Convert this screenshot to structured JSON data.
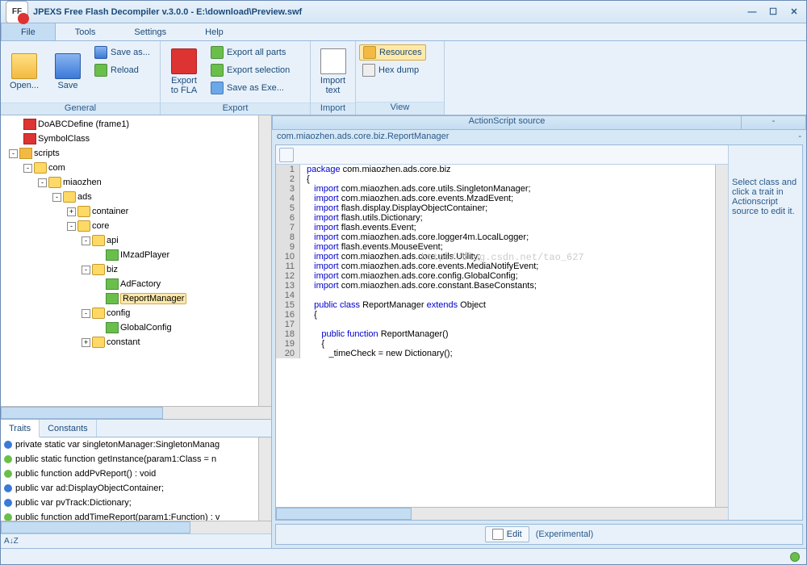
{
  "app": {
    "logo": "FF",
    "title": "JPEXS Free Flash Decompiler v.3.0.0 - E:\\download\\Preview.swf"
  },
  "menu": {
    "file": "File",
    "tools": "Tools",
    "settings": "Settings",
    "help": "Help"
  },
  "ribbon": {
    "general": {
      "label": "General",
      "open": "Open...",
      "save": "Save",
      "saveas": "Save as...",
      "reload": "Reload"
    },
    "export": {
      "label": "Export",
      "tofla": "Export\nto FLA",
      "allparts": "Export all parts",
      "selection": "Export selection",
      "saveasexe": "Save as Exe..."
    },
    "import": {
      "label": "Import",
      "importtext": "Import\ntext"
    },
    "view": {
      "label": "View",
      "resources": "Resources",
      "hexdump": "Hex dump"
    }
  },
  "tree": {
    "n0": "DoABCDefine (frame1)",
    "n1": "SymbolClass",
    "n2": "scripts",
    "n3": "com",
    "n4": "miaozhen",
    "n5": "ads",
    "n6": "container",
    "n7": "core",
    "n8": "api",
    "n9": "IMzadPlayer",
    "n10": "biz",
    "n11": "AdFactory",
    "n12": "ReportManager",
    "n13": "config",
    "n14": "GlobalConfig",
    "n15": "constant"
  },
  "traits": {
    "tab1": "Traits",
    "tab2": "Constants",
    "t0": "private static var singletonManager:SingletonManag",
    "t1": "public static function getInstance(param1:Class = n",
    "t2": "public function addPvReport() : void",
    "t3": "public var ad:DisplayObjectContainer;",
    "t4": "public var pvTrack:Dictionary;",
    "t5": "public function addTimeReport(param1:Function) : v",
    "sort": "A↓Z"
  },
  "source": {
    "title": "ActionScript source",
    "mini": "-",
    "path": "com.miaozhen.ads.core.biz.ReportManager",
    "pathm": "-",
    "info": "Select class and click a trait in Actionscript source to edit it.",
    "edit": "Edit",
    "exp": "(Experimental)",
    "lines": [
      {
        "n": "1",
        "pre": "",
        "kw": "package",
        "post": " com.miaozhen.ads.core.biz"
      },
      {
        "n": "2",
        "pre": "",
        "kw": "",
        "post": "{"
      },
      {
        "n": "3",
        "pre": "   ",
        "kw": "import",
        "post": " com.miaozhen.ads.core.utils.SingletonManager;"
      },
      {
        "n": "4",
        "pre": "   ",
        "kw": "import",
        "post": " com.miaozhen.ads.core.events.MzadEvent;"
      },
      {
        "n": "5",
        "pre": "   ",
        "kw": "import",
        "post": " flash.display.DisplayObjectContainer;"
      },
      {
        "n": "6",
        "pre": "   ",
        "kw": "import",
        "post": " flash.utils.Dictionary;"
      },
      {
        "n": "7",
        "pre": "   ",
        "kw": "import",
        "post": " flash.events.Event;"
      },
      {
        "n": "8",
        "pre": "   ",
        "kw": "import",
        "post": " com.miaozhen.ads.core.logger4m.LocalLogger;"
      },
      {
        "n": "9",
        "pre": "   ",
        "kw": "import",
        "post": " flash.events.MouseEvent;"
      },
      {
        "n": "10",
        "pre": "   ",
        "kw": "import",
        "post": " com.miaozhen.ads.core.utils.Utility;"
      },
      {
        "n": "11",
        "pre": "   ",
        "kw": "import",
        "post": " com.miaozhen.ads.core.events.MediaNotifyEvent;"
      },
      {
        "n": "12",
        "pre": "   ",
        "kw": "import",
        "post": " com.miaozhen.ads.core.config.GlobalConfig;"
      },
      {
        "n": "13",
        "pre": "   ",
        "kw": "import",
        "post": " com.miaozhen.ads.core.constant.BaseConstants;"
      },
      {
        "n": "14",
        "pre": "",
        "kw": "",
        "post": ""
      },
      {
        "n": "15",
        "pre": "   ",
        "kw": "public class",
        "post": " ReportManager ",
        "kw2": "extends",
        "post2": " Object"
      },
      {
        "n": "16",
        "pre": "   ",
        "kw": "",
        "post": "{"
      },
      {
        "n": "17",
        "pre": "",
        "kw": "",
        "post": ""
      },
      {
        "n": "18",
        "pre": "      ",
        "kw": "public function",
        "post": " ReportManager()"
      },
      {
        "n": "19",
        "pre": "      ",
        "kw": "",
        "post": "{"
      },
      {
        "n": "20",
        "pre": "         ",
        "kw": "",
        "post": "_timeCheck = new Dictionary();"
      }
    ]
  },
  "watermark": "http://blog.csdn.net/tao_627"
}
